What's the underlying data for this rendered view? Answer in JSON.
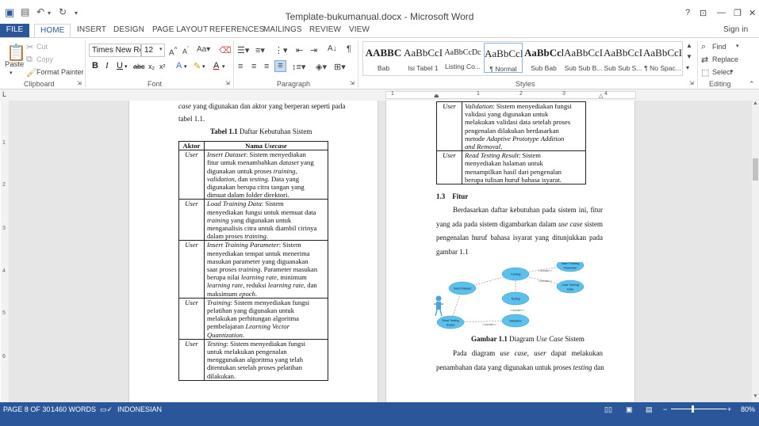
{
  "window": {
    "title": "Template-bukumanual.docx - Microsoft Word",
    "help": "?",
    "sign_in": "Sign in"
  },
  "tabs": [
    "FILE",
    "HOME",
    "INSERT",
    "DESIGN",
    "PAGE LAYOUT",
    "REFERENCES",
    "MAILINGS",
    "REVIEW",
    "VIEW"
  ],
  "ribbon": {
    "clipboard": {
      "paste": "Paste",
      "cut": "Cut",
      "copy": "Copy",
      "format_painter": "Format Painter",
      "label": "Clipboard"
    },
    "font": {
      "name": "Times New Ro",
      "size": "12",
      "label": "Font"
    },
    "paragraph": {
      "label": "Paragraph"
    },
    "styles": {
      "label": "Styles",
      "items": [
        {
          "sample": "AABBC",
          "name": "Bab"
        },
        {
          "sample": "AaBbCcI",
          "name": "Isi Tabel 1"
        },
        {
          "sample": "AaBbCcDc",
          "name": "Listing Co..."
        },
        {
          "sample": "AaBbCcI",
          "name": "¶ Normal"
        },
        {
          "sample": "AaBbCcl",
          "name": "Sub Bab"
        },
        {
          "sample": "AaBbCcI",
          "name": "Sub Sub B..."
        },
        {
          "sample": "AaBbCcI",
          "name": "Sub Sub S..."
        },
        {
          "sample": "AaBbCcI",
          "name": "¶ No Spac..."
        }
      ]
    },
    "editing": {
      "find": "Find",
      "replace": "Replace",
      "select": "Select",
      "label": "Editing"
    }
  },
  "ruler": {
    "numbers": [
      "1",
      "1",
      "2",
      "3",
      "4"
    ],
    "vertical": [
      "1",
      "2",
      "3",
      "4",
      "5",
      "6"
    ]
  },
  "page1": {
    "intro_line1_italic": "case",
    "intro_line1_rest": " yang digunakan dan aktor yang berperan seperti pada",
    "intro_line2": "tabel 1.1.",
    "caption_bold": "Tabel 1.1",
    "caption_rest": " Daftar Kebutuhan Sistem",
    "table_header": {
      "actor": "Aktor",
      "name_plain": "Nama ",
      "name_italic": "Usecase"
    },
    "rows": [
      {
        "actor": "User",
        "lines": [
          "Insert Dataset: Sistem menyediakan",
          "fitur untuk menambahkan dataset yang",
          "digunakan untuk proses training,",
          "validation, dan testing. Data yang",
          "digunakan berupa citra tangan yang",
          "dimuat dalam folder direktori."
        ]
      },
      {
        "actor": "User",
        "lines": [
          "Load Training Data: Sistem",
          "menyediakan fungsi untuk memuat data",
          "training yang digunakan untuk",
          "menganalisis citra untuk diambil cirinya",
          "dalam proses training."
        ]
      },
      {
        "actor": "User",
        "lines": [
          "Insert Training Parameter: Sistem",
          "menyediakan tempat untuk menerima",
          "masukan parameter yang diguanakan",
          "saat proses training. Parameter masukan",
          "berupa nilai learning rate, minimum",
          "learning rate, reduksi learning rate, dan",
          "maksimum epoch."
        ]
      },
      {
        "actor": "User",
        "lines": [
          "Training: Sistem menyediakan fungsi",
          "pelatihan yang digunakan untuk",
          "melakukan perhitungan algoritma",
          "pembelajaran Learning Vector",
          "Quantization."
        ]
      },
      {
        "actor": "User",
        "lines": [
          "Testing: Sistem menyediakan fungsi",
          "untuk melakukan pengenalan",
          "menggunakan algoritma yang telah",
          "ditentukan setelah proses pelatihan",
          "dilakukan."
        ]
      }
    ]
  },
  "page2": {
    "rows": [
      {
        "actor": "User",
        "lines": [
          "Validation: Sistem menyediakan fungsi",
          "validasi yang digunakan untuk",
          "melakukan validasi data setelah proses",
          "pengenalan dilakukan berdasarkan",
          "metode Adaptive Prototype Addition",
          "and Removal."
        ]
      },
      {
        "actor": "User",
        "lines": [
          "Read Testing Result: Sistem",
          "menyediakan halaman untuk",
          "menampilkan hasil dari pengenalan",
          "berupa tulisan huruf bahasa isyarat."
        ]
      }
    ],
    "section_num": "1.3",
    "section_title": "Fitur",
    "para1": [
      "Berdasarkan daftar kebutuhan pada sistem ini, fitur",
      "yang ada pada sistem digambarkan dalam use case sistem",
      "pengenalan huruf bahasa isyarat yang ditunjukkan pada",
      "gambar 1.1"
    ],
    "diagram_nodes": [
      "Insert Dataset",
      "Training",
      "Validation",
      "Testing",
      "Insert Training Parameter",
      "Load Training Data",
      "Read Testing Result"
    ],
    "diagram_labels": [
      "<<include>>",
      "<<include>>",
      "<<include>>",
      "<<include>>"
    ],
    "figure_bold": "Gambar 1.1",
    "figure_rest_plain": " Diagram ",
    "figure_rest_italic": "Use Case",
    "figure_rest_end": " Sistem",
    "para2": [
      "Pada diagram use case, user dapat melakukan",
      "penambahan data yang digunakan untuk proses testing dan"
    ]
  },
  "status": {
    "page": "PAGE 8 OF 30",
    "words": "1460 WORDS",
    "language": "INDONESIAN",
    "zoom": "80%"
  }
}
